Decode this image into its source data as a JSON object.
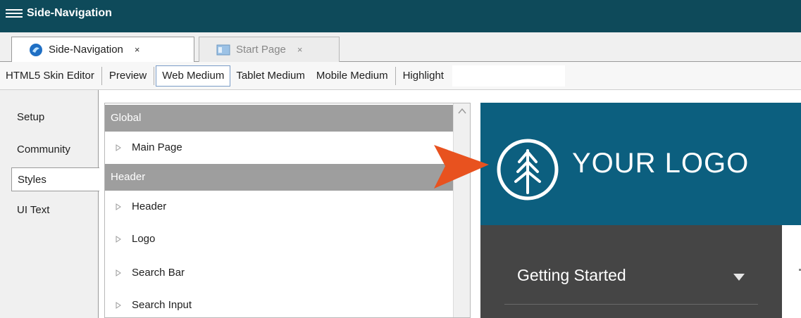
{
  "window": {
    "title": "Side-Navigation"
  },
  "tabs": [
    {
      "label": "Side-Navigation",
      "close": "×"
    },
    {
      "label": "Start Page",
      "close": "×"
    }
  ],
  "toolbar": {
    "skin_editor": "HTML5 Skin Editor",
    "preview": "Preview",
    "web_medium": "Web Medium",
    "tablet_medium": "Tablet Medium",
    "mobile_medium": "Mobile Medium",
    "highlight": "Highlight"
  },
  "side_tabs": [
    "Setup",
    "Community",
    "Styles",
    "UI Text"
  ],
  "tree": {
    "categories": [
      "Global",
      "Header"
    ],
    "items": [
      "Main Page",
      "Header",
      "Logo",
      "Search Bar",
      "Search Input"
    ]
  },
  "preview": {
    "logo_text": "YOUR LOGO",
    "nav_item": "Getting Started"
  },
  "colors": {
    "titlebar": "#0e4a5a",
    "header": "#0c5f7f",
    "nav_bg": "#454545",
    "category_bg": "#9e9e9e",
    "callout": "#e8521f"
  }
}
